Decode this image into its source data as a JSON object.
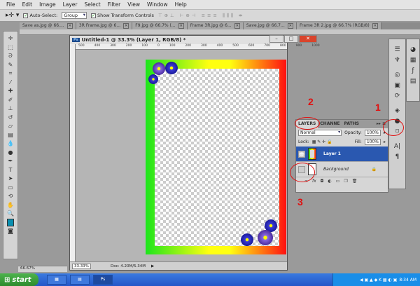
{
  "menu": [
    "File",
    "Edit",
    "Image",
    "Layer",
    "Select",
    "Filter",
    "View",
    "Window",
    "Help"
  ],
  "options": {
    "auto_select_label": "Auto-Select:",
    "auto_select_value": "Group",
    "show_transform_label": "Show Transform Controls"
  },
  "doc_tabs": [
    "Save as.jpg @ 66....",
    "3R Frame.jpg @ 6...",
    "F9.jpg @ 66.7% (...",
    "Frame 3R.jpg @ 6...",
    "Save.jpg @ 66.7...",
    "Frame 3R 2.jpg @ 66.7% (RGB/8)"
  ],
  "document": {
    "title": "Untitled-1 @ 33.3% (Layer 1, RGB/8) *",
    "zoom": "33.33%",
    "doc_info": "Doc: 4.20M/5.34M",
    "ruler": [
      "500",
      "400",
      "300",
      "200",
      "100",
      "0",
      "100",
      "200",
      "300",
      "400",
      "500",
      "600",
      "700",
      "800",
      "900",
      "1000"
    ]
  },
  "left_status": "66.67%",
  "layers_panel": {
    "tabs": [
      "LAYERS",
      "CHANNE",
      "PATHS"
    ],
    "blend_mode": "Normal",
    "opacity_label": "Opacity:",
    "opacity": "100%",
    "lock_label": "Lock:",
    "fill_label": "Fill:",
    "fill": "100%",
    "layers": [
      {
        "name": "Layer 1",
        "selected": true
      },
      {
        "name": "Background",
        "selected": false
      }
    ]
  },
  "annotations": [
    "1",
    "2",
    "3"
  ],
  "taskbar": {
    "start": "start",
    "clock": "8:34 AM",
    "app_label": "Ps"
  },
  "colors": {
    "accent": "#2a58b0",
    "annotation": "#e01010",
    "foreground": "#0a8fb0"
  }
}
